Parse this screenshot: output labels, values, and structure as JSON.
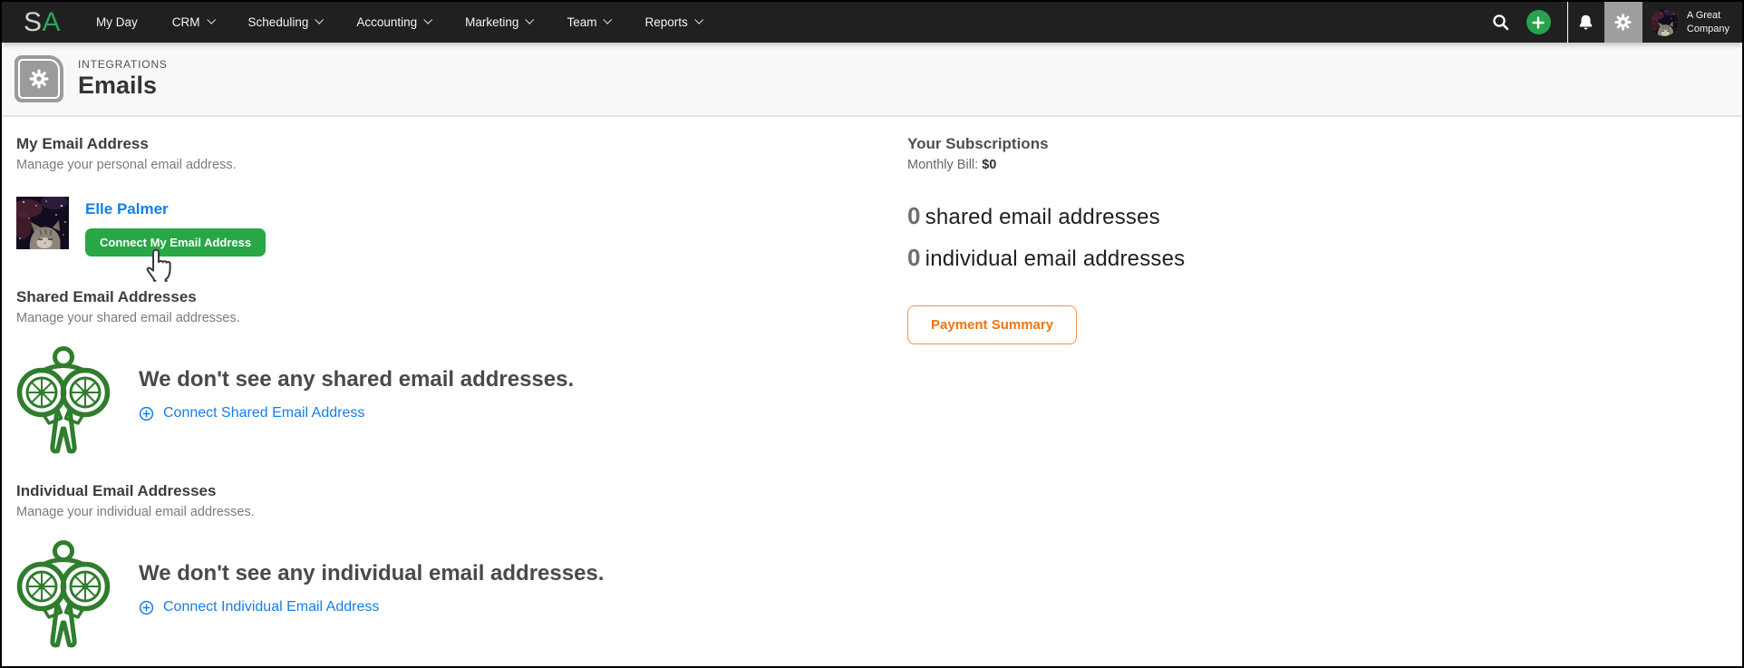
{
  "nav": {
    "logo_s": "S",
    "logo_a": "A",
    "items": [
      {
        "label": "My Day"
      },
      {
        "label": "CRM"
      },
      {
        "label": "Scheduling"
      },
      {
        "label": "Accounting"
      },
      {
        "label": "Marketing"
      },
      {
        "label": "Team"
      },
      {
        "label": "Reports"
      }
    ],
    "company_line1": "A Great",
    "company_line2": "Company"
  },
  "header": {
    "eyebrow": "INTEGRATIONS",
    "title": "Emails"
  },
  "my_email": {
    "heading": "My Email Address",
    "subheading": "Manage your personal email address.",
    "user_name": "Elle Palmer",
    "connect_button": "Connect My Email Address"
  },
  "shared": {
    "heading": "Shared Email Addresses",
    "subheading": "Manage your shared email addresses.",
    "empty_message": "We don't see any shared email addresses.",
    "connect_link": "Connect Shared Email Address"
  },
  "individual": {
    "heading": "Individual Email Addresses",
    "subheading": "Manage your individual email addresses.",
    "empty_message": "We don't see any individual email addresses.",
    "connect_link": "Connect Individual Email Address"
  },
  "subscriptions": {
    "heading": "Your Subscriptions",
    "monthly_bill_label": "Monthly Bill:",
    "monthly_bill_value": "$0",
    "counts": [
      {
        "value": "0",
        "label": "shared email addresses"
      },
      {
        "value": "0",
        "label": "individual email addresses"
      }
    ],
    "payment_button": "Payment Summary"
  },
  "icons": {
    "search": "magnifier",
    "add": "plus-in-green-circle",
    "notifications": "bell",
    "settings": "gear",
    "nav_caret": "chevron-down",
    "integrations": "gear-card",
    "empty_state": "green-binoculars-figure",
    "connect": "plus-in-circle",
    "pointer": "hand-cursor"
  },
  "colors": {
    "nav_bg": "#1F201F",
    "accent_green": "#28A745",
    "logo_green": "#2FA45C",
    "link_blue": "#157EE8",
    "orange_text": "#EE7611",
    "orange_border": "#F0944C",
    "mascot_green": "#2F7D2D",
    "settings_highlight": "#9E9E9E",
    "header_band": "#F8F8F8"
  }
}
